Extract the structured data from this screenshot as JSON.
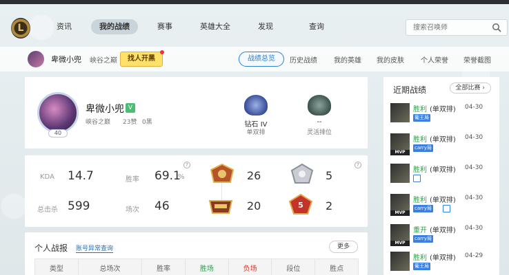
{
  "nav": {
    "logo_letter": "L",
    "items": [
      {
        "label": "资讯"
      },
      {
        "label": "我的战绩"
      },
      {
        "label": "赛事"
      },
      {
        "label": "英雄大全"
      },
      {
        "label": "发现"
      },
      {
        "label": "查询"
      }
    ],
    "search_placeholder": "搜索召唤师"
  },
  "subnav": {
    "user_name": "卑微小兜",
    "server": "峡谷之巅",
    "find_button": "找人开黑",
    "tabs": [
      {
        "label": "战绩总览"
      },
      {
        "label": "历史战绩"
      },
      {
        "label": "我的英雄"
      },
      {
        "label": "我的皮肤"
      },
      {
        "label": "个人荣誉"
      },
      {
        "label": "荣誉截图"
      }
    ]
  },
  "profile": {
    "level": "40",
    "name": "卑微小兜",
    "verified_tag": "V",
    "server": "峡谷之巅",
    "likes": "23赞",
    "blacklist": "0黑",
    "ranks": [
      {
        "tier": "钻石 IV",
        "queue": "单双排"
      },
      {
        "tier": "--",
        "queue": "灵活排位"
      }
    ]
  },
  "stats": {
    "kda_label": "KDA",
    "kda_value": "14.7",
    "winrate_label": "胜率",
    "winrate_value": "69.1",
    "winrate_unit": "%",
    "kills_label": "总击杀",
    "kills_value": "599",
    "games_label": "场次",
    "games_value": "46",
    "question_mark": "?",
    "badges": [
      {
        "name": "mvp-badge",
        "value": "26"
      },
      {
        "name": "legendary-badge",
        "value": "5"
      },
      {
        "name": "carry-badge",
        "value": "20"
      },
      {
        "name": "penta-badge",
        "value": "2"
      }
    ],
    "penta_number": "5"
  },
  "report": {
    "title": "个人战报",
    "link": "账号异常查询",
    "more": "更多",
    "columns": [
      "类型",
      "总场次",
      "胜率",
      "胜场",
      "负场",
      "段位",
      "胜点"
    ]
  },
  "recent": {
    "title": "近期战绩",
    "filter": "全部比赛",
    "rows": [
      {
        "result": "胜利",
        "mode": "(单双排)",
        "date": "04-30",
        "badge": "葡王局",
        "tag": "",
        "extra_icon": false
      },
      {
        "result": "胜利",
        "mode": "(单双排)",
        "date": "04-30",
        "badge": "carry局",
        "tag": "MVP",
        "extra_icon": false
      },
      {
        "result": "胜利",
        "mode": "(单双排)",
        "date": "04-30",
        "badge": "",
        "tag": "",
        "extra_icon": true
      },
      {
        "result": "胜利",
        "mode": "(单双排)",
        "date": "04-30",
        "badge": "carry局",
        "tag": "MVP",
        "extra_icon": true
      },
      {
        "result": "重开",
        "mode": "(单双排)",
        "date": "04-30",
        "badge": "carry局",
        "tag": "MVP",
        "extra_icon": false
      },
      {
        "result": "胜利",
        "mode": "(单双排)",
        "date": "04-29",
        "badge": "葡王局",
        "tag": "",
        "extra_icon": false
      }
    ]
  },
  "colors": {
    "accent": "#2a7fd0",
    "win": "#2e9e4a",
    "lose": "#d9342b",
    "find_button": "#ffe16a"
  }
}
